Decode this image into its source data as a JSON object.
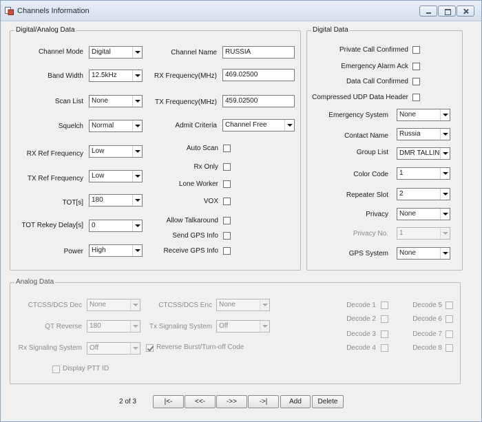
{
  "window": {
    "title": "Channels Information"
  },
  "digital_analog": {
    "title": "Digital/Analog Data",
    "channel_mode": {
      "label": "Channel Mode",
      "value": "Digital"
    },
    "band_width": {
      "label": "Band Width",
      "value": "12.5kHz"
    },
    "scan_list": {
      "label": "Scan List",
      "value": "None"
    },
    "squelch": {
      "label": "Squelch",
      "value": "Normal"
    },
    "rx_ref": {
      "label": "RX Ref Frequency",
      "value": "Low"
    },
    "tx_ref": {
      "label": "TX Ref Frequency",
      "value": "Low"
    },
    "tot": {
      "label": "TOT[s]",
      "value": "180"
    },
    "tot_rekey": {
      "label": "TOT Rekey Delay[s]",
      "value": "0"
    },
    "power": {
      "label": "Power",
      "value": "High"
    },
    "channel_name": {
      "label": "Channel Name",
      "value": "RUSSIA"
    },
    "rx_freq": {
      "label": "RX Frequency(MHz)",
      "value": "469.02500"
    },
    "tx_freq": {
      "label": "TX Frequency(MHz)",
      "value": "459.02500"
    },
    "admit_criteria": {
      "label": "Admit Criteria",
      "value": "Channel Free"
    },
    "auto_scan": "Auto Scan",
    "rx_only": "Rx Only",
    "lone_worker": "Lone Worker",
    "vox": "VOX",
    "allow_talkaround": "Allow Talkaround",
    "send_gps": "Send GPS Info",
    "receive_gps": "Receive GPS Info"
  },
  "digital": {
    "title": "Digital Data",
    "private_call": "Private Call Confirmed",
    "emergency_ack": "Emergency Alarm Ack",
    "data_call": "Data Call Confirmed",
    "compressed_udp": "Compressed UDP Data Header",
    "emergency_system": {
      "label": "Emergency System",
      "value": "None"
    },
    "contact_name": {
      "label": "Contact Name",
      "value": "Russia"
    },
    "group_list": {
      "label": "Group List",
      "value": "DMR TALLIN"
    },
    "color_code": {
      "label": "Color Code",
      "value": "1"
    },
    "repeater_slot": {
      "label": "Repeater Slot",
      "value": "2"
    },
    "privacy": {
      "label": "Privacy",
      "value": "None"
    },
    "privacy_no": {
      "label": "Privacy No.",
      "value": "1"
    },
    "gps_system": {
      "label": "GPS System",
      "value": "None"
    }
  },
  "analog": {
    "title": "Analog Data",
    "ctcss_dec": {
      "label": "CTCSS/DCS Dec",
      "value": "None"
    },
    "ctcss_enc": {
      "label": "CTCSS/DCS Enc",
      "value": "None"
    },
    "qt_reverse": {
      "label": "QT Reverse",
      "value": "180"
    },
    "tx_signaling": {
      "label": "Tx Signaling System",
      "value": "Off"
    },
    "rx_signaling": {
      "label": "Rx Signaling System",
      "value": "Off"
    },
    "reverse_burst": "Reverse Burst/Turn-off Code",
    "display_ptt": "Display PTT ID",
    "decodes": [
      "Decode 1",
      "Decode 2",
      "Decode 3",
      "Decode 4",
      "Decode 5",
      "Decode 6",
      "Decode 7",
      "Decode 8"
    ]
  },
  "pager": {
    "position": "2 of 3",
    "first": "|<-",
    "prev": "<<-",
    "next": "->>",
    "last": "->|",
    "add": "Add",
    "delete": "Delete"
  }
}
